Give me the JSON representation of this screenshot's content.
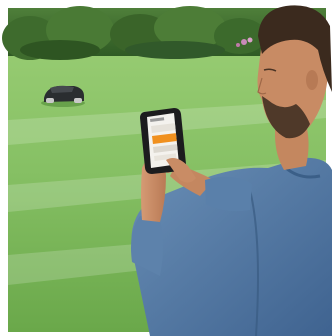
{
  "image": {
    "type": "photo",
    "subject": "man-using-phone-app-to-control-robotic-lawn-mower"
  },
  "palette": {
    "lawn_light": "#8cc46a",
    "lawn_dark": "#5f9a3e",
    "hedge": "#3d6a2e",
    "mower_body": "#2a2d30",
    "shirt_denim": "#5a7fa6",
    "skin": "#c68a64",
    "hair": "#3b2a1e",
    "phone_frame": "#1c1c1e",
    "app_accent": "#f0901e"
  },
  "icons": [
    "robot-mower",
    "smartphone"
  ]
}
